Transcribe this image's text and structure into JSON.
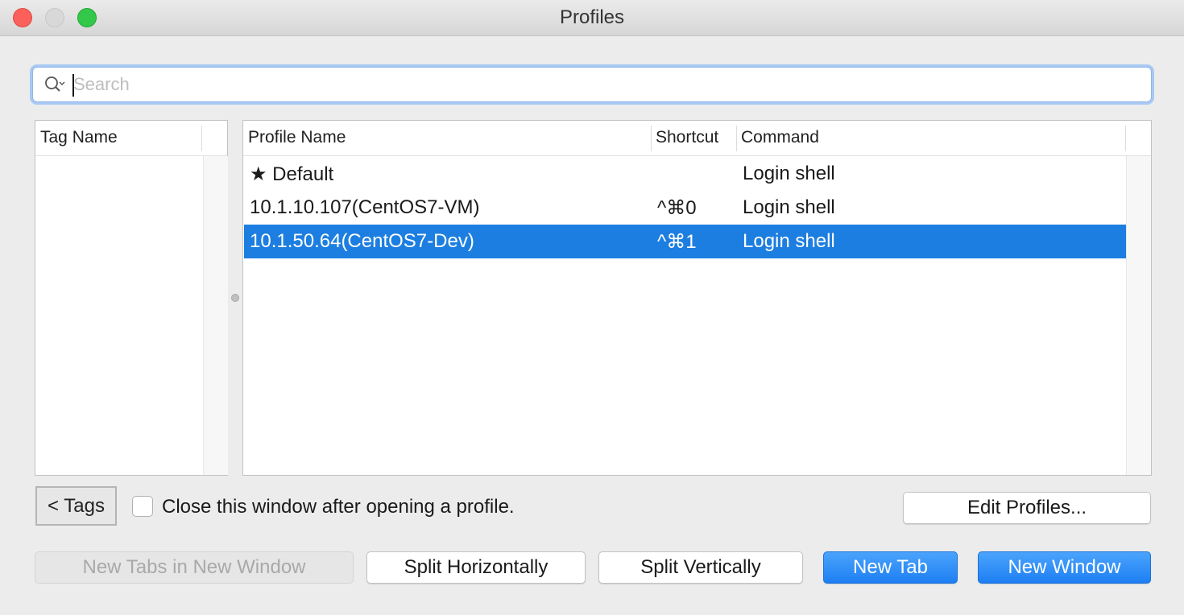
{
  "window": {
    "title": "Profiles"
  },
  "search": {
    "placeholder": "Search",
    "value": ""
  },
  "tags_table": {
    "header": "Tag Name",
    "rows": []
  },
  "profiles_table": {
    "headers": {
      "name": "Profile Name",
      "shortcut": "Shortcut",
      "command": "Command"
    },
    "rows": [
      {
        "name": "★ Default",
        "shortcut": "",
        "command": "Login shell",
        "selected": false
      },
      {
        "name": "10.1.10.107(CentOS7-VM)",
        "shortcut": "^⌘0",
        "command": "Login shell",
        "selected": false
      },
      {
        "name": "10.1.50.64(CentOS7-Dev)",
        "shortcut": "^⌘1",
        "command": "Login shell",
        "selected": true
      }
    ]
  },
  "controls": {
    "tags_button": "< Tags",
    "close_after_open_label": "Close this window after opening a profile.",
    "close_after_open_checked": false,
    "edit_profiles_button": "Edit Profiles..."
  },
  "actions": {
    "new_tabs_in_new_window": "New Tabs in New Window",
    "split_horizontally": "Split Horizontally",
    "split_vertically": "Split Vertically",
    "new_tab": "New Tab",
    "new_window": "New Window"
  },
  "colors": {
    "selection": "#1c7ee0",
    "primary_button": "#1d7ff3",
    "focus_ring": "#a9c9f3"
  }
}
